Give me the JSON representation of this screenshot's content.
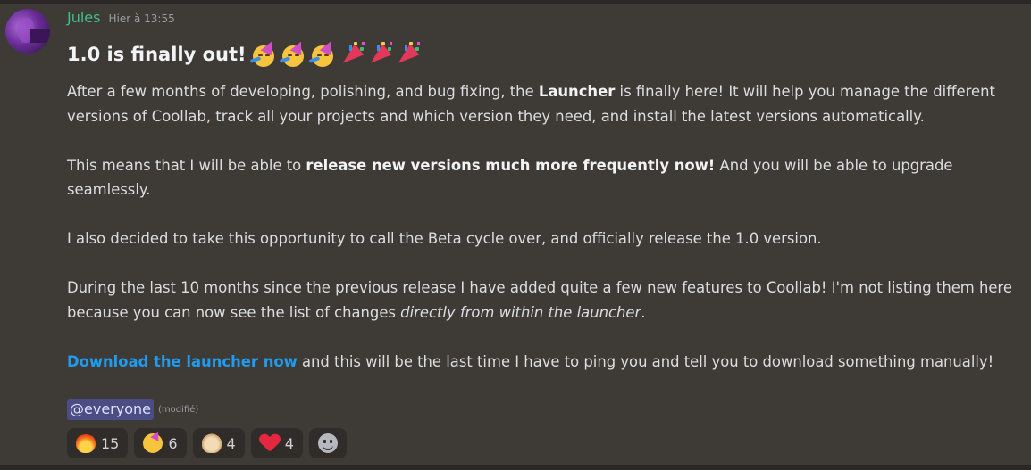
{
  "message": {
    "author": "Jules",
    "timestamp": "Hier à 13:55",
    "title": "1.0 is finally out!",
    "title_emojis": [
      "partying-face",
      "partying-face",
      "partying-face",
      "party-popper",
      "party-popper",
      "party-popper"
    ],
    "paragraphs": [
      {
        "p1a": "After a few months of developing, polishing, and bug fixing, the ",
        "p1b": "Launcher",
        "p1c": " is finally here! It will help you manage the different versions of Coollab, track all your projects and which version they need, and install the latest versions automatically."
      },
      {
        "p2a": "This means that I will be able to ",
        "p2b": "release new versions much more frequently now!",
        "p2c": " And you will be able to upgrade seamlessly."
      },
      {
        "p3": "I also decided to take this opportunity to call the Beta cycle over, and officially release the 1.0 version."
      },
      {
        "p4a": "During the last 10 months since the previous release I have added quite a few new features to Coollab! I'm not listing them here because you can now see the list of changes ",
        "p4b": "directly from within the launcher",
        "p4c": "."
      },
      {
        "p5a": "Download the launcher now",
        "p5b": " and this will be the last time I have to ping you and tell you to download something manually!"
      }
    ],
    "mention": "@everyone",
    "edited_label": "(modifié)",
    "reactions": [
      {
        "emoji": "fire-icon",
        "count": "15"
      },
      {
        "emoji": "partying-face-icon",
        "count": "6"
      },
      {
        "emoji": "dog-icon",
        "count": "4"
      },
      {
        "emoji": "heart-icon",
        "count": "4"
      }
    ],
    "colors": {
      "background": "#3e3a36",
      "username": "#3fbf8a",
      "link": "#1f9bf0",
      "mention_bg": "#4b4d85"
    }
  }
}
